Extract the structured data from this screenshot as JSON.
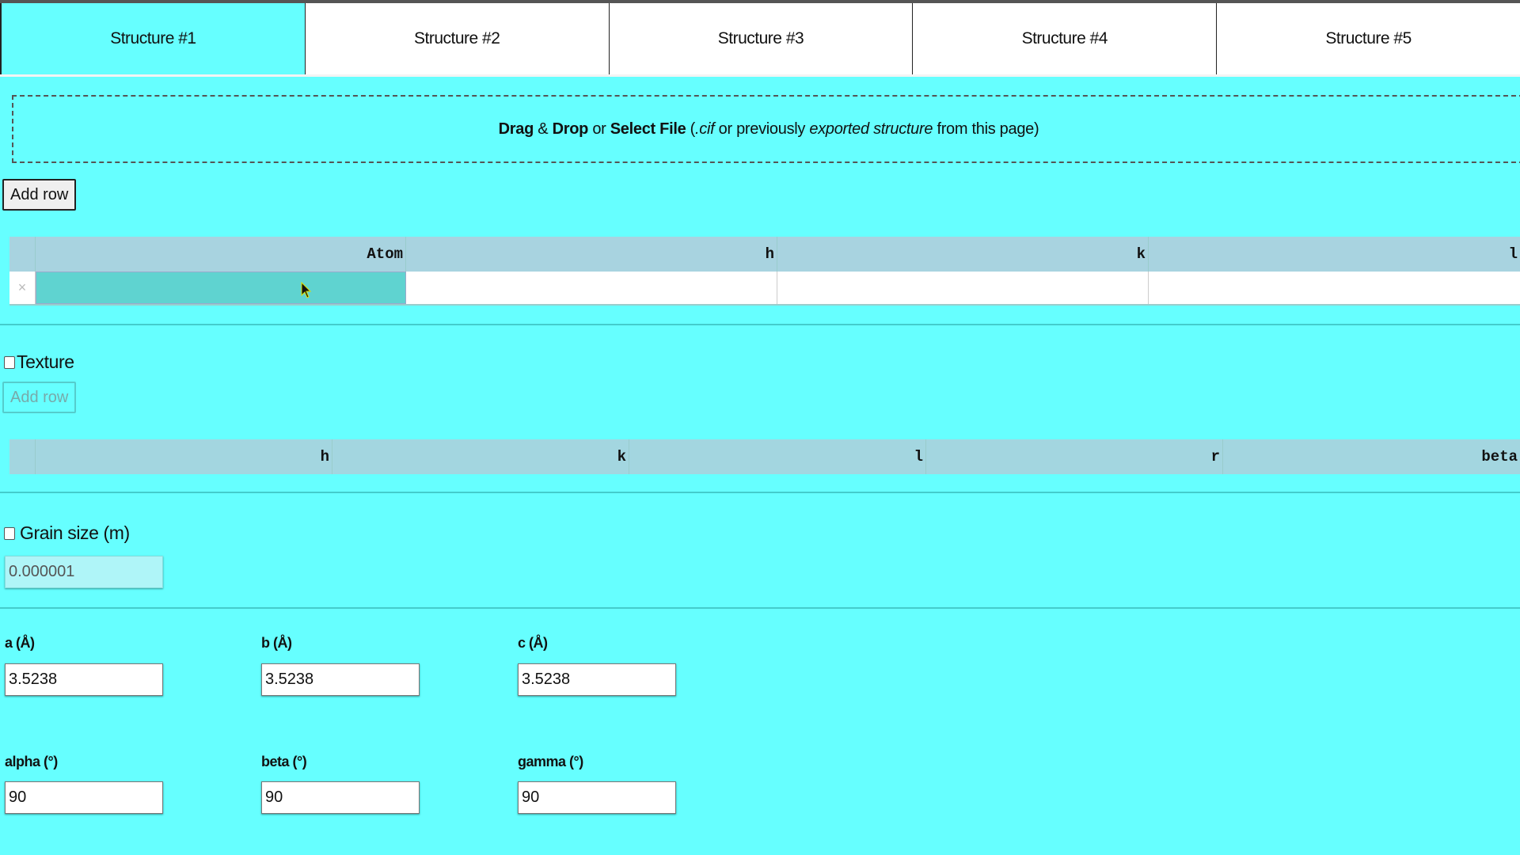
{
  "tabs": [
    "Structure #1",
    "Structure #2",
    "Structure #3",
    "Structure #4",
    "Structure #5"
  ],
  "drop": {
    "b1": "Drag",
    "amp": " & ",
    "b2": "Drop",
    "or": " or ",
    "b3": "Select File",
    "p1": " (",
    "i1": ".cif",
    "p2": " or previously ",
    "i2": "exported structure",
    "p3": " from this page)"
  },
  "atoms": {
    "add_row": "Add row",
    "headers": [
      "Atom",
      "h",
      "k",
      "l"
    ],
    "delete": "×"
  },
  "texture": {
    "label": "Texture",
    "add_row": "Add row",
    "headers": [
      "h",
      "k",
      "l",
      "r",
      "beta"
    ]
  },
  "grain": {
    "label": "Grain size (m)",
    "value": "0.000001"
  },
  "lattice": {
    "a_label": "a (Å)",
    "a": "3.5238",
    "b_label": "b (Å)",
    "b": "3.5238",
    "c_label": "c (Å)",
    "c": "3.5238",
    "alpha_label": "alpha (°)",
    "alpha": "90",
    "beta_label": "beta (°)",
    "beta": "90",
    "gamma_label": "gamma (°)",
    "gamma": "90"
  }
}
